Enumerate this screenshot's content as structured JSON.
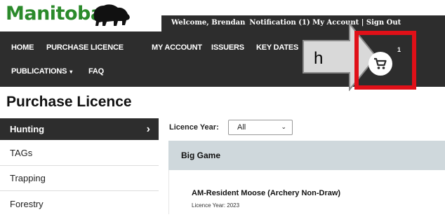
{
  "brand": {
    "logo_text": "Manitoba"
  },
  "header": {
    "welcome_text": "Welcome, Brendan",
    "notification_text": "Notification (1) My Account | Sign Out"
  },
  "nav": {
    "items": [
      {
        "label": "HOME"
      },
      {
        "label": "PURCHASE LICENCE"
      },
      {
        "label": "MY ACCOUNT"
      },
      {
        "label": "ISSUERS"
      },
      {
        "label": "KEY DATES"
      },
      {
        "label": "PUBLICATIONS"
      },
      {
        "label": "FAQ"
      }
    ],
    "publications_caret": "▾"
  },
  "cart": {
    "icon": "cart-icon",
    "badge_count": "1"
  },
  "callout": {
    "letter": "h",
    "highlight_color": "#e01018"
  },
  "page_title": "Purchase Licence",
  "sidebar": {
    "items": [
      {
        "label": "Hunting"
      },
      {
        "label": "TAGs"
      },
      {
        "label": "Trapping"
      },
      {
        "label": "Forestry"
      }
    ],
    "active_chevron": "›"
  },
  "filter": {
    "label": "Licence Year:",
    "selected": "All",
    "arrow": "⌄"
  },
  "section": {
    "title": "Big Game"
  },
  "product": {
    "title": "AM-Resident Moose (Archery Non-Draw)",
    "subtitle": "Licence Year: 2023"
  },
  "colors": {
    "brand_green": "#2b8a2b",
    "nav_bg": "#2d2d2d",
    "section_bg": "#cfd8dc",
    "highlight": "#e01018"
  }
}
